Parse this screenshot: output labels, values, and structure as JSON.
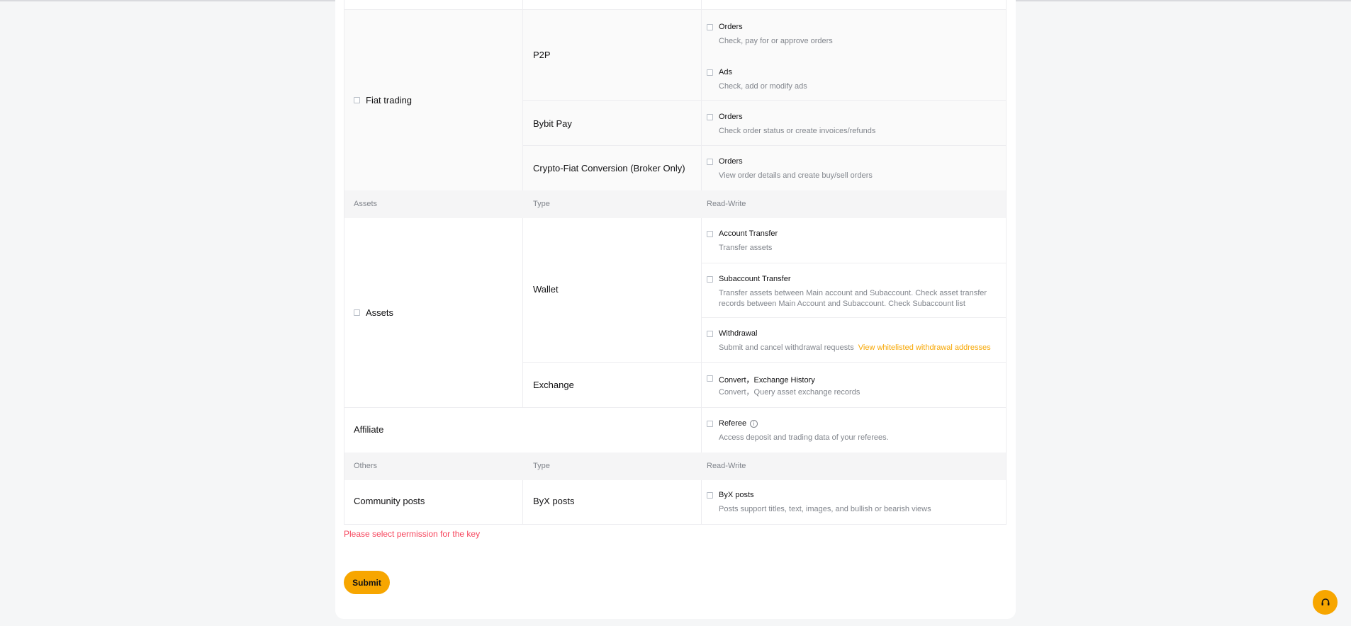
{
  "fiat": {
    "category": "Fiat trading",
    "p2p": {
      "type": "P2P",
      "orders": {
        "title": "Orders",
        "desc": "Check, pay for or approve orders"
      },
      "ads": {
        "title": "Ads",
        "desc": "Check, add or modify ads"
      }
    },
    "bybit_pay": {
      "type": "Bybit Pay",
      "title": "Orders",
      "desc": "Check order status or create invoices/refunds"
    },
    "crypto_fiat": {
      "type": "Crypto-Fiat Conversion (Broker Only)",
      "title": "Orders",
      "desc": "View order details and create buy/sell orders"
    }
  },
  "assets_header": {
    "col1": "Assets",
    "col2": "Type",
    "col3": "Read-Write"
  },
  "assets": {
    "category": "Assets",
    "wallet": {
      "type": "Wallet",
      "account_transfer": {
        "title": "Account Transfer",
        "desc": "Transfer assets"
      },
      "subaccount_transfer": {
        "title": "Subaccount Transfer",
        "desc": "Transfer assets between Main account and Subaccount. Check asset transfer records between Main Account and Subaccount. Check Subaccount list"
      },
      "withdrawal": {
        "title": "Withdrawal",
        "desc": "Submit and cancel withdrawal requests",
        "link": "View whitelisted withdrawal addresses"
      }
    },
    "exchange": {
      "type": "Exchange",
      "title": "Convert，Exchange History",
      "desc": "Convert，Query asset exchange records"
    }
  },
  "affiliate": {
    "category": "Affiliate",
    "title": "Referee",
    "desc": "Access deposit and trading data of your referees."
  },
  "others_header": {
    "col1": "Others",
    "col2": "Type",
    "col3": "Read-Write"
  },
  "community": {
    "category": "Community posts",
    "type": "ByX posts",
    "title": "ByX posts",
    "desc": "Posts support titles, text, images, and bullish or bearish views"
  },
  "error_text": "Please select permission for the key",
  "submit_label": "Submit",
  "colors": {
    "accent": "#f7a600",
    "error": "#f6465d",
    "muted": "#81858c"
  },
  "icons": {
    "info": "info-circle-icon",
    "support": "headset-icon"
  }
}
